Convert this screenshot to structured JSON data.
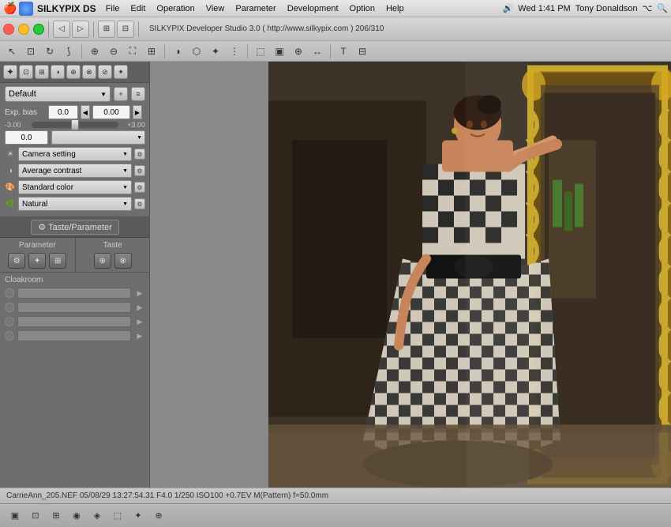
{
  "menubar": {
    "apple": "🍎",
    "app_icon": "●",
    "app_name": "SILKYPIX DS",
    "items": [
      "File",
      "Edit",
      "Operation",
      "View",
      "Parameter",
      "Development",
      "Option",
      "Help"
    ],
    "volume_icon": "🔊",
    "time": "Wed 1:41 PM",
    "user": "Tony Donaldson",
    "bluetooth": "⌥",
    "search": "🔍"
  },
  "toolbar": {
    "title": "SILKYPIX Developer Studio 3.0 ( http://www.silkypix.com )   206/310"
  },
  "left_panel": {
    "preset_label": "Default",
    "exp_bias_label": "Exp. bias",
    "exp_bias_value": "0.0",
    "exp_bias_value2": "0.00",
    "slider_min": "-3.00",
    "slider_max": "+3.00",
    "slider_value": "0.0",
    "camera_setting": "Camera setting",
    "contrast": "Average contrast",
    "color": "Standard color",
    "natural": "Natural",
    "taste_param_label": "Taste/Parameter",
    "param_header": "Parameter",
    "taste_header": "Taste",
    "cloakroom_header": "Cloakroom",
    "cloak_rows": [
      {
        "id": 1
      },
      {
        "id": 2
      },
      {
        "id": 3
      },
      {
        "id": 4
      }
    ]
  },
  "statusbar": {
    "text": "CarrieAnn_205.NEF 05/08/29 13:27:54.31 F4.0 1/250 ISO100 +0.7EV M(Pattern) f=50.0mm"
  },
  "icons": {
    "gear": "⚙",
    "star": "✦",
    "arrow_right": "▶",
    "arrow_left": "◀",
    "down_arrow": "▼",
    "up_arrow": "▲",
    "plus": "+",
    "close": "✕",
    "sun": "☀",
    "contrast_icon": "◑",
    "palette": "🎨",
    "leaf": "🌿",
    "tool": "🔧",
    "wrench": "⊞",
    "copy": "⧉",
    "paste": "⧊"
  },
  "bottom_toolbar": {
    "items": [
      "▣",
      "▦",
      "⊡",
      "◉",
      "◈",
      "⬚",
      "✦"
    ]
  }
}
